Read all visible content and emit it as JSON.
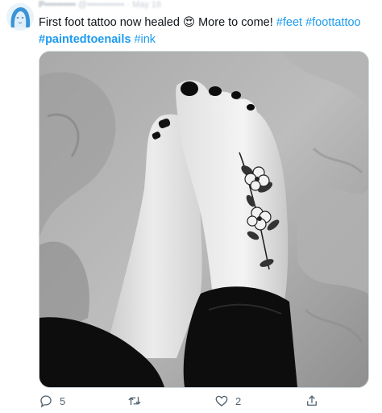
{
  "tweet": {
    "author_name": "P••••••••••",
    "author_handle": "@•••••••••••• · May 16",
    "text_plain": "First foot tattoo now healed",
    "emoji": "😍",
    "text_after_emoji": " More to come! ",
    "hashtags": [
      "#feet",
      "#foottattoo",
      "#paintedtoenails",
      "#ink"
    ]
  },
  "actions": {
    "reply_count": "5",
    "like_count": "2"
  },
  "icons": {
    "reply": "speech-bubble-icon",
    "retweet": "retweet-icon",
    "like": "heart-icon",
    "share": "share-icon"
  },
  "colors": {
    "link": "#1d9bf0",
    "text": "#0f1419",
    "muted": "#536471",
    "border": "#cfd9de"
  }
}
